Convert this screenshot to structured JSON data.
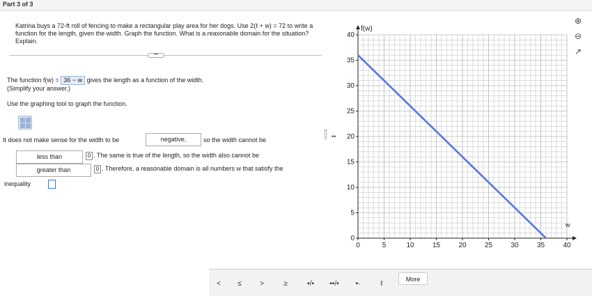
{
  "header": {
    "part": "Part 3 of 3"
  },
  "question": {
    "text": "Katrina buys a 72-ft roll of fencing to make a rectangular play area for her dogs. Use",
    "equation": "2(ℓ + w) = 72",
    "to": "to",
    "text_rest": "write a function for the length, given the width. Graph the function. What is a reasonable domain for the situation? Explain."
  },
  "answer": {
    "function_prefix": "The function",
    "function_name": "f(w) =",
    "function_value": "36 − w",
    "function_suffix": "gives the length as a function of the width.",
    "simplify": "(Simplify your answer.)",
    "graph_instruction": "Use the graphing tool to graph the function.",
    "sentence1_start": "It does not make sense for the width to be",
    "dropdown1": "negative,",
    "sentence1_end": "so the width cannot be",
    "dropdown2": "less than",
    "zero1": "0",
    "sentence2": ". The same is true of the length, so the width also cannot be",
    "dropdown3": "greater than",
    "zero2": "0",
    "sentence3": ". Therefore, a reasonable domain is all numbers w that satisfy the",
    "inequality_label": "inequality"
  },
  "toolbar": {
    "buttons": [
      "<",
      "≤",
      ">",
      "≥",
      "▪/▪",
      "▪▪/▪",
      "▪·",
      "ℓ"
    ],
    "more": "More"
  },
  "chart_data": {
    "type": "line",
    "ylabel": "f(w)",
    "xlabel": "w",
    "xlim": [
      0,
      40
    ],
    "ylim": [
      0,
      40
    ],
    "x_ticks": [
      0,
      5,
      10,
      15,
      20,
      25,
      30,
      35,
      40
    ],
    "y_ticks": [
      0,
      5,
      10,
      15,
      20,
      25,
      30,
      35,
      40
    ],
    "grid": true,
    "series": [
      {
        "x": [
          0,
          36
        ],
        "y": [
          36,
          0
        ],
        "color": "#5577dd"
      }
    ]
  }
}
